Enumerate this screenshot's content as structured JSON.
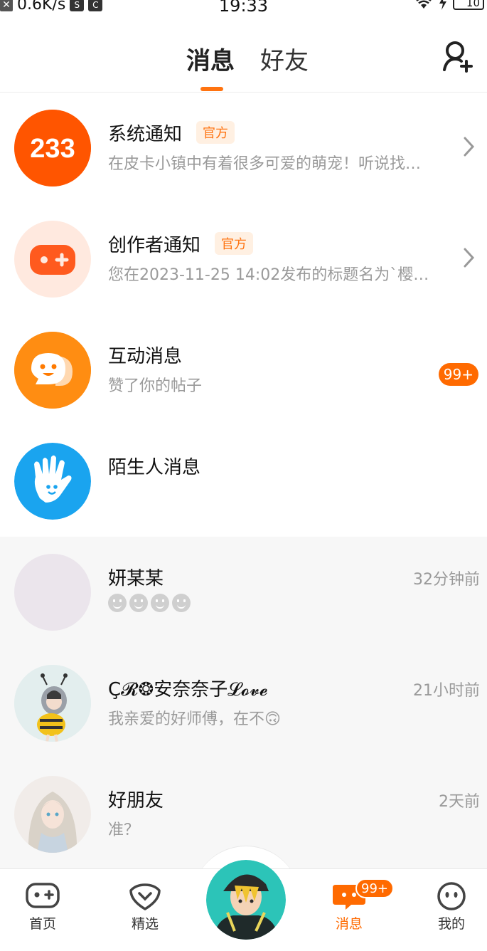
{
  "status_bar": {
    "net_speed": "0.6K/s",
    "time": "19:33",
    "battery": "10",
    "icons": [
      "close-icon",
      "s-app-icon",
      "c-app-icon",
      "wifi-icon",
      "charging-icon",
      "battery-icon"
    ]
  },
  "header": {
    "tab_messages": "消息",
    "tab_friends": "好友",
    "active_tab": "消息",
    "add_friend_icon": "add-friend-icon",
    "accent_color": "#ff7310"
  },
  "system_rows": [
    {
      "title": "系统通知",
      "badge": "官方",
      "subtitle": "在皮卡小镇中有着很多可爱的萌宠！听说找…",
      "avatar_text": "233",
      "icon": "chevron-right-icon"
    },
    {
      "title": "创作者通知",
      "badge": "官方",
      "subtitle": "您在2023-11-25 14:02发布的标题名为`樱…",
      "icon": "chevron-right-icon"
    },
    {
      "title": "互动消息",
      "subtitle": "赞了你的帖子",
      "count": "99+"
    },
    {
      "title": "陌生人消息"
    }
  ],
  "conversations": [
    {
      "name": "妍某某",
      "time": "32分钟前",
      "emoji_count": 4
    },
    {
      "name": "Ç𝓡❂安奈奈子𝓛𝓸𝓿𝓮",
      "time": "21小时前",
      "preview": "我亲爱的好师傅，在不",
      "emoji": "🙃"
    },
    {
      "name": "好朋友",
      "time": "2天前",
      "preview": "准？"
    }
  ],
  "bottom_nav": {
    "items": [
      {
        "label": "首页",
        "icon": "gamepad-icon"
      },
      {
        "label": "精选",
        "icon": "heart-badge-icon"
      },
      {
        "label": "消息",
        "icon": "message-bubble-icon",
        "active": true
      },
      {
        "label": "我的",
        "icon": "face-icon"
      }
    ],
    "message_badge": "99+"
  }
}
